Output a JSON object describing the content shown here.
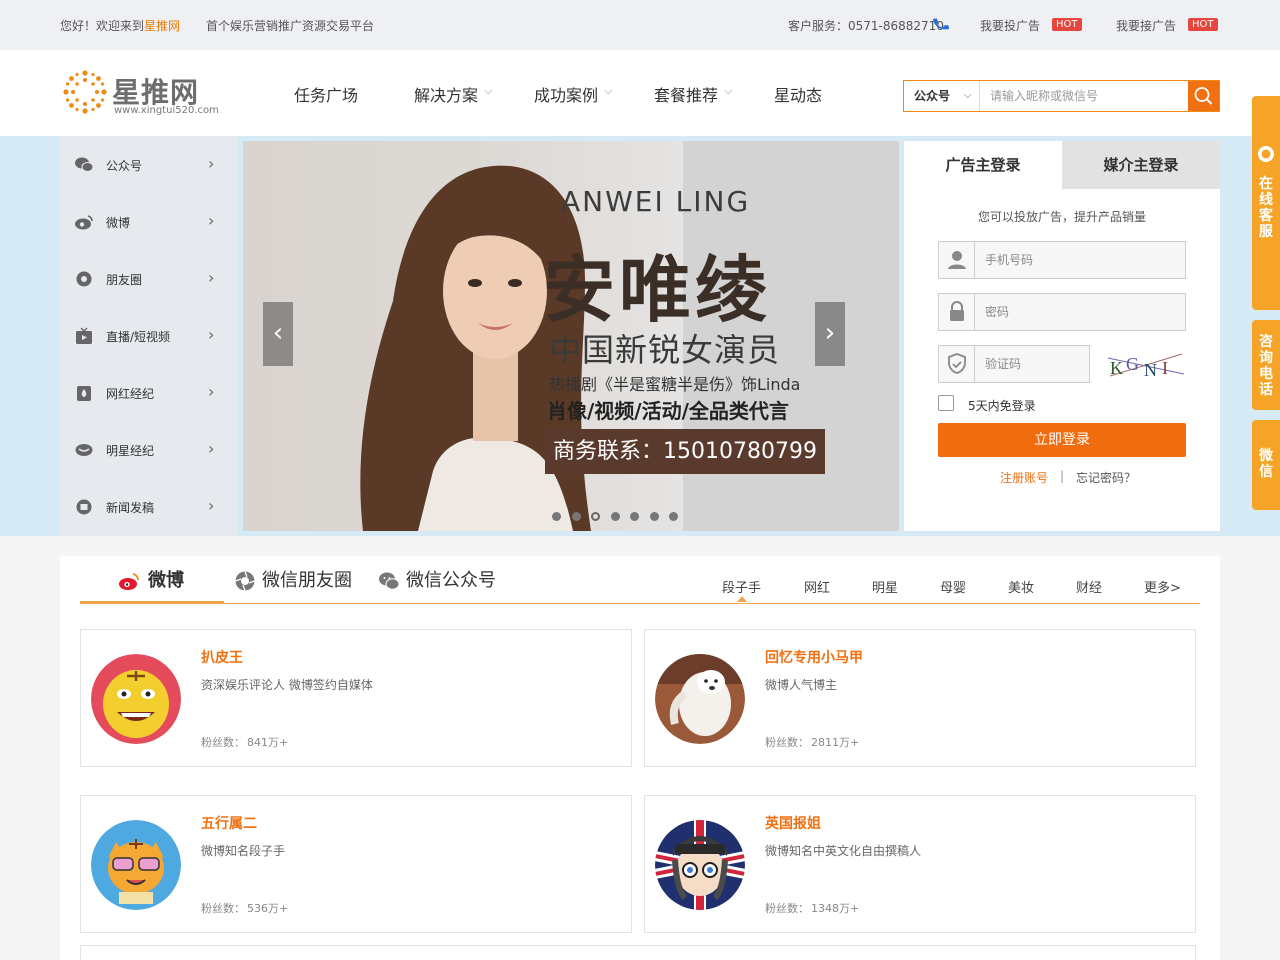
{
  "topbar": {
    "welcome_prefix": "您好！欢迎来到",
    "welcome_brand": "星推网",
    "slogan": "首个娱乐营销推广资源交易平台",
    "service": "客户服务：0571-86882710",
    "ad_post": "我要投广告",
    "ad_take": "我要接广告",
    "hot": "HOT"
  },
  "logo": {
    "text": "星推网",
    "url": "www.xingtui520.com"
  },
  "nav": [
    "任务广场",
    "解决方案",
    "成功案例",
    "套餐推荐",
    "星动态"
  ],
  "search": {
    "select": "公众号",
    "placeholder": "请输入昵称或微信号"
  },
  "categories": [
    "公众号",
    "微博",
    "朋友圈",
    "直播/短视频",
    "网红经纪",
    "明星经纪",
    "新闻发稿"
  ],
  "banner": {
    "title_en": "ANWEI LING",
    "title_zh": "安唯绫",
    "sub1": "中国新锐女演员",
    "sub2": "热播剧《半是蜜糖半是伤》饰Linda",
    "sub3": "肖像/视频/活动/全品类代言",
    "contact": "商务联系：15010780799",
    "slide_count": 7,
    "active_slide": 3
  },
  "login": {
    "tab_advertiser": "广告主登录",
    "tab_media": "媒介主登录",
    "hint": "您可以投放广告，提升产品销量",
    "phone_placeholder": "手机号码",
    "password_placeholder": "密码",
    "captcha_placeholder": "验证码",
    "captcha_text": "KGNI",
    "remember": "5天内免登录",
    "submit": "立即登录",
    "register": "注册账号",
    "separator": "|",
    "forgot": "忘记密码？"
  },
  "float_tabs": [
    "在线客服",
    "咨询电话",
    "微信"
  ],
  "content": {
    "tabs": [
      "微博",
      "微信朋友圈",
      "微信公众号"
    ],
    "subtabs": [
      "段子手",
      "网红",
      "明星",
      "母婴",
      "美妆",
      "财经",
      "更多>"
    ],
    "fans_label": "粉丝数：",
    "cards": [
      {
        "name": "扒皮王",
        "desc": "资深娱乐评论人 微博签约自媒体",
        "fans": "841万+"
      },
      {
        "name": "回忆专用小马甲",
        "desc": "微博人气博主",
        "fans": "2811万+"
      },
      {
        "name": "五行属二",
        "desc": "微博知名段子手",
        "fans": "536万+"
      },
      {
        "name": "英国报姐",
        "desc": "微博知名中英文化自由撰稿人",
        "fans": "1348万+"
      }
    ]
  },
  "colors": {
    "accent": "#f07012",
    "hero_bg": "#d6eaf6",
    "float": "#f5a428",
    "hot": "#e5463e"
  }
}
